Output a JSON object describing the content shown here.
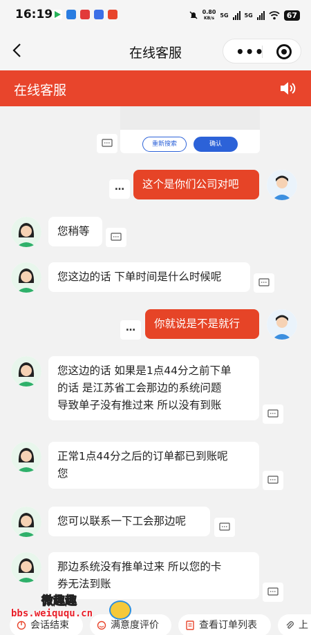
{
  "status_bar": {
    "time": "16:19",
    "net_speed": "0.80",
    "net_unit": "KB/s",
    "sim1": "5G",
    "sim2": "5G",
    "battery": "67"
  },
  "nav": {
    "title": "在线客服"
  },
  "service_header": {
    "title": "在线客服"
  },
  "card": {
    "reset_label": "重新搜索",
    "confirm_label": "确认"
  },
  "messages": [
    {
      "role": "user",
      "text": "这个是你们公司对吧"
    },
    {
      "role": "agent",
      "text": "您稍等"
    },
    {
      "role": "agent",
      "text": "您这边的话 下单时间是什么时候呢"
    },
    {
      "role": "user",
      "text": "你就说是不是就行"
    },
    {
      "role": "agent",
      "lines": [
        "您这边的话 如果是1点44分之前下单",
        "的话 是江苏省工会那边的系统问题",
        "导致单子没有推过来 所以没有到账"
      ]
    },
    {
      "role": "agent",
      "lines": [
        "正常1点44分之后的订单都已到账呢",
        "您"
      ]
    },
    {
      "role": "agent",
      "text": "您可以联系一下工会那边呢"
    },
    {
      "role": "agent",
      "lines": [
        "那边系统没有推单过来 所以您的卡",
        "券无法到账"
      ]
    }
  ],
  "bottom_bar": {
    "end_chat": "会话结束",
    "rate": "满意度评价",
    "orders": "查看订单列表",
    "upload": "上"
  },
  "watermark": {
    "name": "微趣趣",
    "url": "bbs.weiququ.cn"
  },
  "colors": {
    "brand_red": "#e8452c",
    "user_bubble": "#e64427",
    "link_blue": "#2c62d8"
  }
}
